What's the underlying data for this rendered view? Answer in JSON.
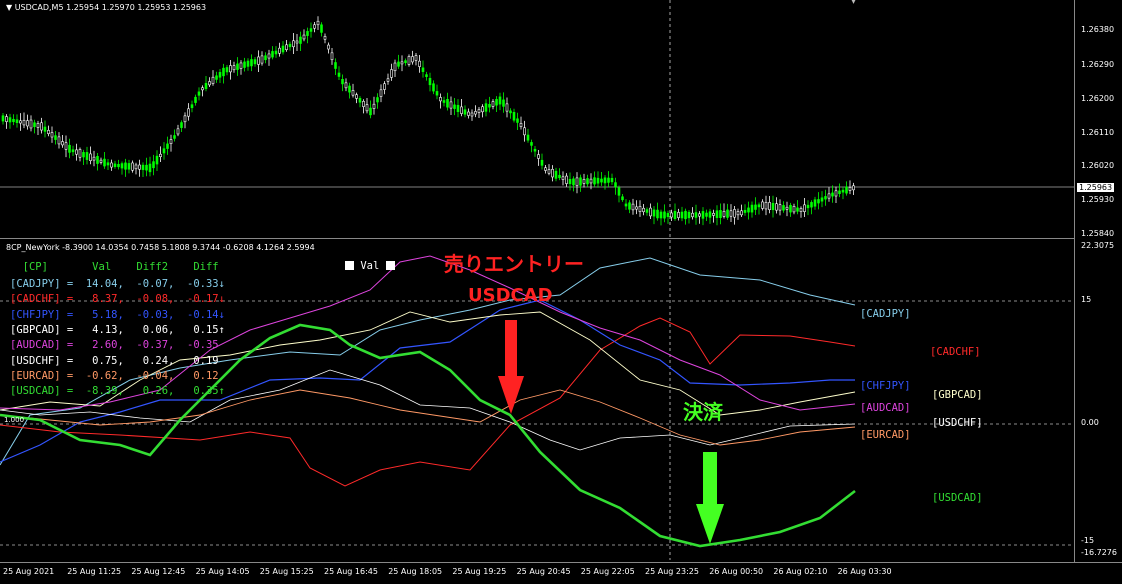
{
  "price_chart": {
    "symbol_header": "USDCAD,M5  1.25954 1.25970 1.25953 1.25963",
    "price_ticks": [
      "1.26380",
      "1.26290",
      "1.26200",
      "1.26110",
      "1.26020",
      "1.25930",
      "1.25840"
    ],
    "current_price": "1.25963",
    "up_color": "#00ff00",
    "down_color": "#ffffff"
  },
  "indicator": {
    "header": "8CP_NewYork -8.3900 14.0354 0.7458 5.1808 9.3744 -0.6208 4.1264 2.5994",
    "val_button": "Val",
    "table_header": "  [CP]       Val    Diff2    Diff",
    "rows": [
      {
        "text": "[CADJPY] =  14.04,  -0.07,  -0.33↓",
        "color": "#87ceeb"
      },
      {
        "text": "[CADCHF] =   8.37,  -0.08,  -0.17↓",
        "color": "#ff2a2a"
      },
      {
        "text": "[CHFJPY] =   5.18,  -0.03,  -0.14↓",
        "color": "#3355ff"
      },
      {
        "text": "[GBPCAD] =   4.13,   0.06,   0.15↑",
        "color": "#ffffff"
      },
      {
        "text": "[AUDCAD] =   2.60,  -0.37,  -0.35",
        "color": "#dd44dd"
      },
      {
        "text": "[USDCHF] =   0.75,   0.24,   0.19",
        "color": "#ffffff"
      },
      {
        "text": "[EURCAD] =  -0.62,  -0.04,   0.12",
        "color": "#ff9966"
      },
      {
        "text": "[USDCAD] =  -8.39,   0.26,   0.35↑",
        "color": "#33dd33"
      }
    ],
    "level_ticks": [
      "22.3075",
      "15",
      "0.00",
      "-15",
      "-16.7276"
    ],
    "left_level_label": "1.000",
    "pair_labels": [
      {
        "name": "[CADJPY]",
        "color": "#87ceeb"
      },
      {
        "name": "[CADCHF]",
        "color": "#ff2a2a"
      },
      {
        "name": "[CHFJPY]",
        "color": "#3355ff"
      },
      {
        "name": "[GBPCAD]",
        "color": "#ffffcc"
      },
      {
        "name": "[AUDCAD]",
        "color": "#dd44dd"
      },
      {
        "name": "[USDCHF]",
        "color": "#ffffff"
      },
      {
        "name": "[EURCAD]",
        "color": "#ff9966"
      },
      {
        "name": "[USDCAD]",
        "color": "#33dd33"
      }
    ]
  },
  "annotations": {
    "sell_entry": "売りエントリー",
    "sell_symbol": "USDCAD",
    "settle": "決済",
    "sell_color": "#ff2222",
    "settle_color": "#44ff22"
  },
  "time_axis": [
    "25 Aug 2021",
    "25 Aug 11:25",
    "25 Aug 12:45",
    "25 Aug 14:05",
    "25 Aug 15:25",
    "25 Aug 16:45",
    "25 Aug 18:05",
    "25 Aug 19:25",
    "25 Aug 20:45",
    "25 Aug 22:05",
    "25 Aug 23:25",
    "26 Aug 00:50",
    "26 Aug 02:10",
    "26 Aug 03:30"
  ]
}
